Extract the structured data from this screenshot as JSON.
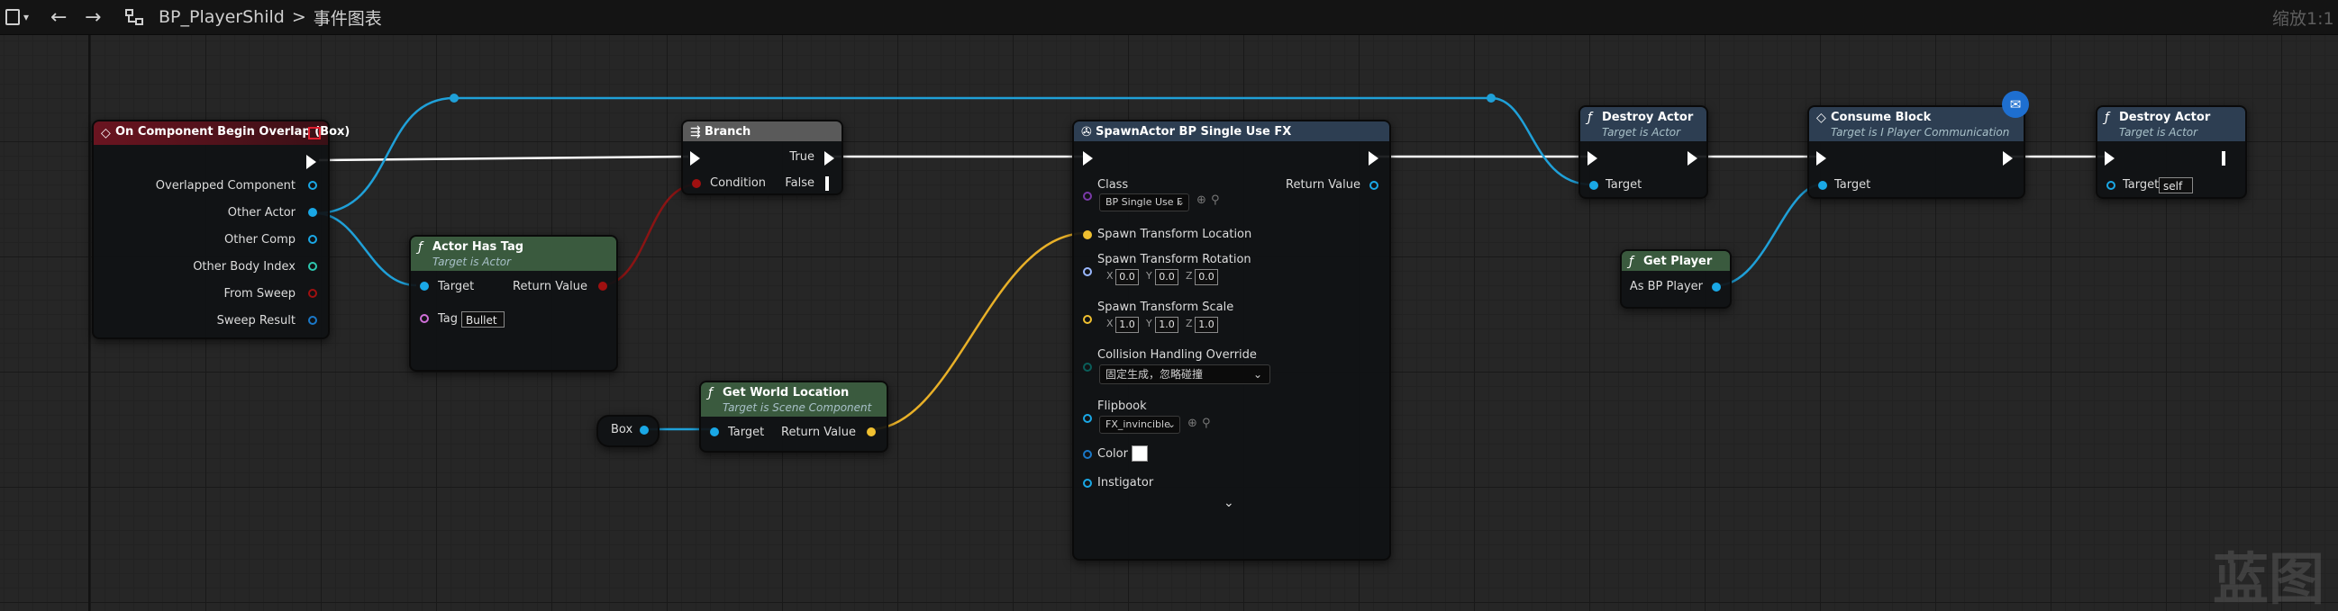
{
  "toolbar": {
    "breadcrumb_asset": "BP_PlayerShild",
    "breadcrumb_separator": ">",
    "breadcrumb_graph": "事件图表",
    "zoom": "缩放1:1"
  },
  "watermark": "蓝图",
  "colors": {
    "exec_wire": "#ffffff",
    "object_wire": "#1fa0d8",
    "bool_wire": "#8a1414",
    "vector_wire": "#e8b028",
    "object_pin": "#1aa8e6",
    "bool_pin": "#a01010",
    "vector_pin": "#f0c030",
    "event_header": "#5a1218",
    "function_header": "#2d3e52",
    "pure_header": "#3a5a3e"
  },
  "nodes": {
    "on_overlap": {
      "title": "On Component Begin Overlap (Box)",
      "pins": [
        "Overlapped Component",
        "Other Actor",
        "Other Comp",
        "Other Body Index",
        "From Sweep",
        "Sweep Result"
      ]
    },
    "actor_has_tag": {
      "title": "Actor Has Tag",
      "subtitle": "Target is Actor",
      "target": "Target",
      "return": "Return Value",
      "tag_label": "Tag",
      "tag_value": "Bullet"
    },
    "branch": {
      "title": "Branch",
      "condition": "Condition",
      "true_label": "True",
      "false_label": "False"
    },
    "box_var": {
      "label": "Box"
    },
    "get_world_location": {
      "title": "Get World Location",
      "subtitle": "Target is Scene Component",
      "target": "Target",
      "return": "Return Value"
    },
    "spawn_actor": {
      "title": "SpawnActor BP Single Use FX",
      "class_label": "Class",
      "class_value": "BP Single Use F",
      "return": "Return Value",
      "spawn_location": "Spawn Transform Location",
      "spawn_rotation": "Spawn Transform Rotation",
      "rotation": {
        "x": "0.0",
        "y": "0.0",
        "z": "0.0"
      },
      "spawn_scale": "Spawn Transform Scale",
      "scale": {
        "x": "1.0",
        "y": "1.0",
        "z": "1.0"
      },
      "axis_x": "X",
      "axis_y": "Y",
      "axis_z": "Z",
      "collision_label": "Collision Handling Override",
      "collision_value": "固定生成，忽略碰撞",
      "flipbook_label": "Flipbook",
      "flipbook_value": "FX_invincible",
      "color_label": "Color",
      "color_value": "#ffffff",
      "instigator_label": "Instigator"
    },
    "destroy_actor_1": {
      "title": "Destroy Actor",
      "subtitle": "Target is Actor",
      "target": "Target"
    },
    "get_player": {
      "title": "Get Player",
      "output": "As BP Player"
    },
    "consume_block": {
      "title": "Consume Block",
      "subtitle": "Target is I Player Communication",
      "target": "Target"
    },
    "destroy_actor_2": {
      "title": "Destroy Actor",
      "subtitle": "Target is Actor",
      "target": "Target",
      "target_value": "self"
    }
  }
}
